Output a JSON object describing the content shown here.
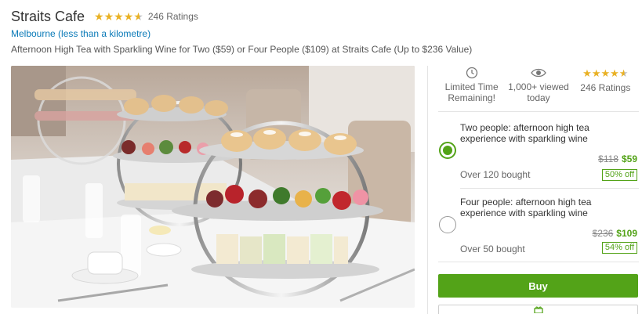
{
  "deal": {
    "title": "Straits Cafe",
    "rating": 4.5,
    "ratings_count": "246 Ratings",
    "location": "Melbourne (less than a kilometre)",
    "subtitle": "Afternoon High Tea with Sparkling Wine for Two ($59) or Four People ($109) at Straits Cafe (Up to $236 Value)"
  },
  "badges": {
    "time": {
      "icon": "clock-icon",
      "line1": "Limited Time",
      "line2": "Remaining!"
    },
    "views": {
      "icon": "eye-icon",
      "line1": "1,000+ viewed",
      "line2": "today"
    },
    "rating": {
      "stars": 4.5,
      "label": "246 Ratings"
    }
  },
  "options": [
    {
      "title": "Two people: afternoon high tea experience with sparkling wine",
      "old_price": "$118",
      "price": "$59",
      "bought": "Over 120 bought",
      "discount": "50% off",
      "selected": true
    },
    {
      "title": "Four people: afternoon high tea experience with sparkling wine",
      "old_price": "$236",
      "price": "$109",
      "bought": "Over 50 bought",
      "discount": "54% off",
      "selected": false
    }
  ],
  "actions": {
    "buy_label": "Buy",
    "gift_icon": "gift-icon"
  },
  "colors": {
    "brand_green": "#53a318",
    "link_blue": "#0a7ab8",
    "star_gold": "#e9b124"
  }
}
